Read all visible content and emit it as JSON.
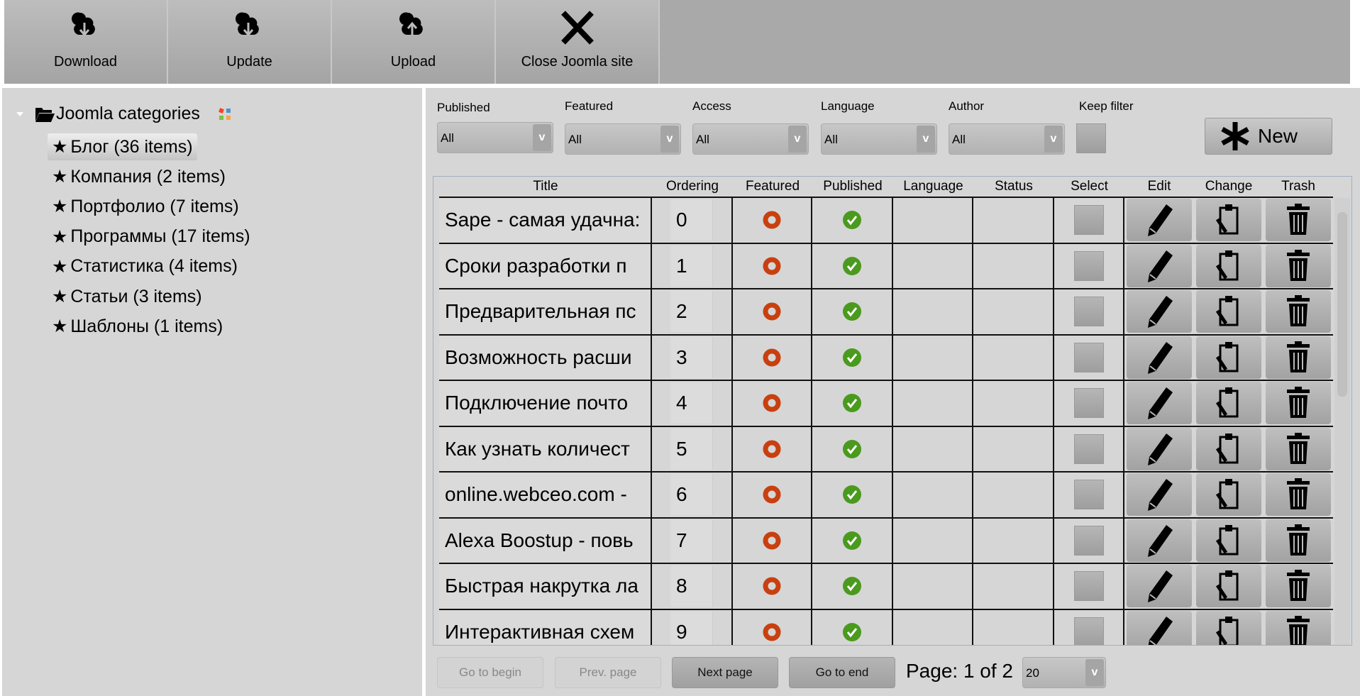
{
  "toolbar": {
    "buttons": [
      {
        "label": "Download",
        "icon": "cloud-download-icon"
      },
      {
        "label": "Update",
        "icon": "cloud-download-icon"
      },
      {
        "label": "Upload",
        "icon": "cloud-upload-icon"
      },
      {
        "label": "Close Joomla site",
        "icon": "close-x-icon"
      }
    ]
  },
  "tree": {
    "root": "Joomla categories",
    "items": [
      {
        "label": "Блог (36 items)",
        "selected": true
      },
      {
        "label": "Компания (2 items)"
      },
      {
        "label": "Портфолио (7 items)"
      },
      {
        "label": "Программы (17 items)"
      },
      {
        "label": "Статистика (4 items)"
      },
      {
        "label": "Статьи (3 items)"
      },
      {
        "label": "Шаблоны (1 items)"
      }
    ]
  },
  "filters": {
    "published": {
      "label": "Published",
      "value": "All"
    },
    "featured": {
      "label": "Featured",
      "value": "All"
    },
    "access": {
      "label": "Access",
      "value": "All"
    },
    "language": {
      "label": "Language",
      "value": "All"
    },
    "author": {
      "label": "Author",
      "value": "All"
    },
    "keep_filter": {
      "label": "Keep filter",
      "checked": false
    }
  },
  "new_label": "New",
  "table": {
    "columns": [
      "Title",
      "Ordering",
      "Featured",
      "Published",
      "Language",
      "Status",
      "Select",
      "Edit",
      "Change",
      "Trash"
    ],
    "rows": [
      {
        "title": "Sape - самая удачна:",
        "ordering": "0"
      },
      {
        "title": "Сроки разработки п",
        "ordering": "1"
      },
      {
        "title": "Предварительная пс",
        "ordering": "2"
      },
      {
        "title": "Возможность расши",
        "ordering": "3"
      },
      {
        "title": "Подключение почто",
        "ordering": "4"
      },
      {
        "title": "Как узнать количест",
        "ordering": "5"
      },
      {
        "title": "online.webceo.com -",
        "ordering": "6"
      },
      {
        "title": "Alexa Boostup - повь",
        "ordering": "7"
      },
      {
        "title": "Быстрая накрутка ла",
        "ordering": "8"
      },
      {
        "title": "Интерактивная схем",
        "ordering": "9"
      }
    ]
  },
  "pagination": {
    "begin": "Go to begin",
    "prev": "Prev. page",
    "next": "Next page",
    "end": "Go to end",
    "info": "Page: 1 of 2",
    "page_size": "20"
  },
  "colors": {
    "featured": "#c8400f",
    "published": "#4a9a1e"
  }
}
